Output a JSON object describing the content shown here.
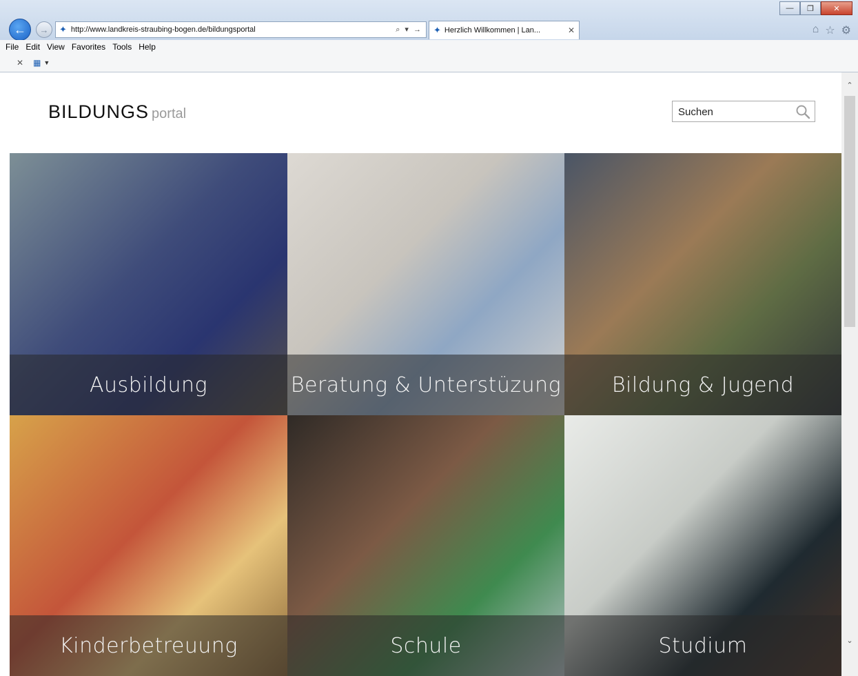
{
  "browser": {
    "url": "http://www.landkreis-straubing-bogen.de/bildungsportal",
    "tab_title": "Herzlich Willkommen | Lan...",
    "menu": [
      "File",
      "Edit",
      "View",
      "Favorites",
      "Tools",
      "Help"
    ],
    "address_tools": "⌕ ▾ →"
  },
  "page": {
    "logo": {
      "main": "BILDUNGS",
      "sub": "portal"
    },
    "search": {
      "placeholder": "Suchen"
    },
    "tiles": [
      {
        "label": "Ausbildung"
      },
      {
        "label": "Beratung & Unterstüzung"
      },
      {
        "label": "Bildung & Jugend"
      },
      {
        "label": "Kinderbetreuung"
      },
      {
        "label": "Schule"
      },
      {
        "label": "Studium"
      }
    ]
  },
  "colors": {
    "accent": "#1b62c6",
    "tile_overlay": "#282828",
    "close_button": "#c8432d"
  }
}
